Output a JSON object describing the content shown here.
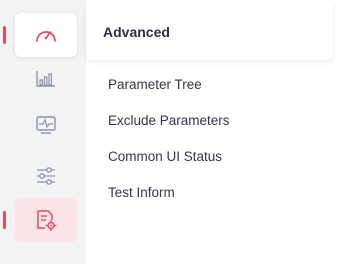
{
  "sidebar": {
    "items": [
      {
        "icon": "speedometer-icon",
        "state": "selected"
      },
      {
        "icon": "bar-chart-icon",
        "state": "default"
      },
      {
        "icon": "activity-monitor-icon",
        "state": "default"
      },
      {
        "icon": "sliders-icon",
        "state": "default"
      },
      {
        "icon": "document-settings-icon",
        "state": "highlighted"
      }
    ],
    "accent_color": "#e34a5b",
    "icon_color": "#8a93a6"
  },
  "panel": {
    "title": "Advanced",
    "items": [
      {
        "label": "Parameter Tree"
      },
      {
        "label": "Exclude Parameters"
      },
      {
        "label": "Common UI Status"
      },
      {
        "label": "Test Inform"
      }
    ]
  }
}
